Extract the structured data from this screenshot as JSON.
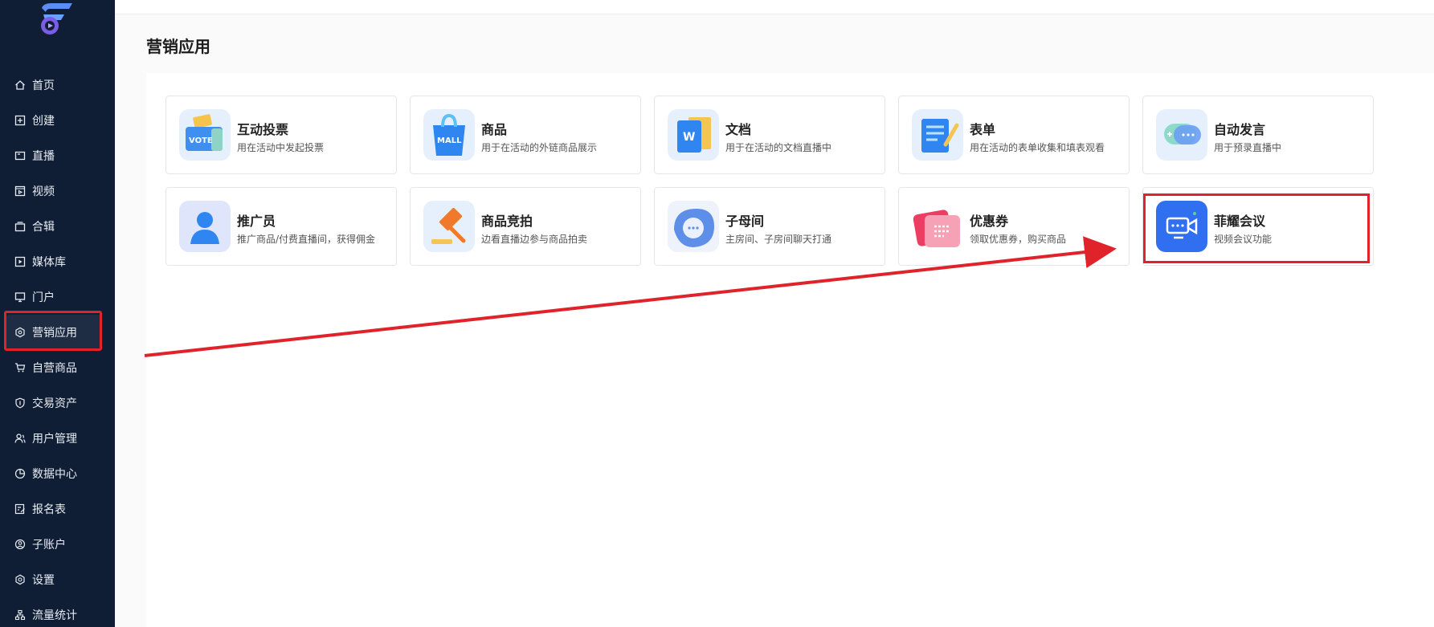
{
  "sidebar": {
    "items": [
      {
        "label": "首页",
        "icon": "home-icon"
      },
      {
        "label": "创建",
        "icon": "plus-square-icon"
      },
      {
        "label": "直播",
        "icon": "live-icon"
      },
      {
        "label": "视频",
        "icon": "video-icon"
      },
      {
        "label": "合辑",
        "icon": "collection-icon"
      },
      {
        "label": "媒体库",
        "icon": "media-library-icon"
      },
      {
        "label": "门户",
        "icon": "monitor-icon"
      },
      {
        "label": "营销应用",
        "icon": "hexagon-icon",
        "active": true
      },
      {
        "label": "自营商品",
        "icon": "cart-icon"
      },
      {
        "label": "交易资产",
        "icon": "shield-icon"
      },
      {
        "label": "用户管理",
        "icon": "users-icon"
      },
      {
        "label": "数据中心",
        "icon": "pie-chart-icon"
      },
      {
        "label": "报名表",
        "icon": "form-edit-icon"
      },
      {
        "label": "子账户",
        "icon": "user-circle-icon"
      },
      {
        "label": "设置",
        "icon": "gear-icon"
      },
      {
        "label": "流量统计",
        "icon": "network-icon"
      }
    ]
  },
  "page": {
    "title": "营销应用"
  },
  "apps": [
    {
      "title": "互动投票",
      "desc": "用在活动中发起投票",
      "icon": "vote-box-icon"
    },
    {
      "title": "商品",
      "desc": "用于在活动的外链商品展示",
      "icon": "mall-bag-icon"
    },
    {
      "title": "文档",
      "desc": "用于在活动的文档直播中",
      "icon": "word-document-icon"
    },
    {
      "title": "表单",
      "desc": "用在活动的表单收集和填表观看",
      "icon": "form-list-icon"
    },
    {
      "title": "自动发言",
      "desc": "用于预录直播中",
      "icon": "chat-bubble-icon"
    },
    {
      "title": "推广员",
      "desc": "推广商品/付费直播间，获得佣金",
      "icon": "promoter-person-icon"
    },
    {
      "title": "商品竞拍",
      "desc": "边看直播边参与商品拍卖",
      "icon": "auction-hammer-icon"
    },
    {
      "title": "子母间",
      "desc": "主房间、子房间聊天打通",
      "icon": "sub-room-chat-icon"
    },
    {
      "title": "优惠券",
      "desc": "领取优惠券，购买商品",
      "icon": "coupon-icon"
    },
    {
      "title": "菲耀会议",
      "desc": "视频会议功能",
      "icon": "video-meeting-icon"
    }
  ],
  "colors": {
    "sidebar_bg": "#0f1e35",
    "annotation_red": "#e0222a"
  }
}
